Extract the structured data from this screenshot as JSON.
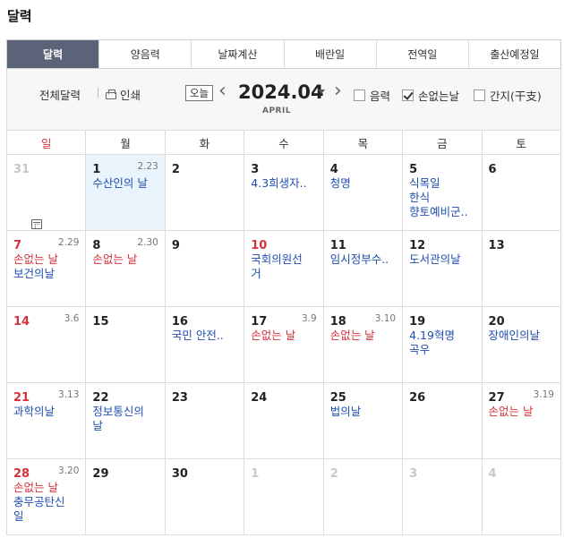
{
  "page": {
    "title": "달력"
  },
  "tabs": [
    {
      "label": "달력",
      "active": true
    },
    {
      "label": "양음력"
    },
    {
      "label": "날짜계산"
    },
    {
      "label": "배란일"
    },
    {
      "label": "전역일"
    },
    {
      "label": "출산예정일"
    }
  ],
  "toolbar": {
    "full_calendar_label": "전체달력",
    "print_label": "인쇄",
    "today_label": "오늘",
    "month_label": "2024.04",
    "month_sub": "APRIL",
    "lunar_label": "음력",
    "lunar_checked": false,
    "sonless_label": "손없는날",
    "sonless_checked": true,
    "ganji_label": "간지(干支)",
    "ganji_checked": false
  },
  "weekdays": [
    "일",
    "월",
    "화",
    "수",
    "목",
    "금",
    "토"
  ],
  "weeks": [
    [
      {
        "day": "31",
        "muted": true
      },
      {
        "day": "1",
        "lunar": "2.23",
        "today": true,
        "events": [
          {
            "text": "수산인의 날"
          }
        ]
      },
      {
        "day": "2"
      },
      {
        "day": "3",
        "events": [
          {
            "text": "4.3희생자.."
          }
        ]
      },
      {
        "day": "4",
        "events": [
          {
            "text": "청명"
          }
        ]
      },
      {
        "day": "5",
        "events": [
          {
            "text": "식목일"
          },
          {
            "text": "한식"
          },
          {
            "text": "향토예비군.."
          }
        ]
      },
      {
        "day": "6"
      }
    ],
    [
      {
        "day": "7",
        "red": true,
        "lunar": "2.29",
        "events": [
          {
            "text": "손없는 날",
            "red": true
          },
          {
            "text": "보건의날"
          }
        ]
      },
      {
        "day": "8",
        "lunar": "2.30",
        "events": [
          {
            "text": "손없는 날",
            "red": true
          }
        ]
      },
      {
        "day": "9"
      },
      {
        "day": "10",
        "red": true,
        "events": [
          {
            "text": "국회의원선\n거"
          }
        ]
      },
      {
        "day": "11",
        "events": [
          {
            "text": "임시정부수.."
          }
        ]
      },
      {
        "day": "12",
        "events": [
          {
            "text": "도서관의날"
          }
        ]
      },
      {
        "day": "13"
      }
    ],
    [
      {
        "day": "14",
        "red": true,
        "lunar": "3.6"
      },
      {
        "day": "15"
      },
      {
        "day": "16",
        "events": [
          {
            "text": "국민 안전.."
          }
        ]
      },
      {
        "day": "17",
        "lunar": "3.9",
        "events": [
          {
            "text": "손없는 날",
            "red": true
          }
        ]
      },
      {
        "day": "18",
        "lunar": "3.10",
        "events": [
          {
            "text": "손없는 날",
            "red": true
          }
        ]
      },
      {
        "day": "19",
        "events": [
          {
            "text": "4.19혁명\n곡우"
          }
        ]
      },
      {
        "day": "20",
        "events": [
          {
            "text": "장애인의날"
          }
        ]
      }
    ],
    [
      {
        "day": "21",
        "red": true,
        "lunar": "3.13",
        "events": [
          {
            "text": "과학의날"
          }
        ]
      },
      {
        "day": "22",
        "events": [
          {
            "text": "정보통신의\n날"
          }
        ]
      },
      {
        "day": "23"
      },
      {
        "day": "24"
      },
      {
        "day": "25",
        "events": [
          {
            "text": "법의날"
          }
        ]
      },
      {
        "day": "26"
      },
      {
        "day": "27",
        "lunar": "3.19",
        "events": [
          {
            "text": "손없는 날",
            "red": true
          }
        ]
      }
    ],
    [
      {
        "day": "28",
        "red": true,
        "lunar": "3.20",
        "events": [
          {
            "text": "손없는 날",
            "red": true
          },
          {
            "text": "충무공탄신\n일"
          }
        ]
      },
      {
        "day": "29"
      },
      {
        "day": "30"
      },
      {
        "day": "1",
        "muted": true
      },
      {
        "day": "2",
        "muted": true
      },
      {
        "day": "3",
        "muted": true
      },
      {
        "day": "4",
        "muted": true
      }
    ]
  ]
}
